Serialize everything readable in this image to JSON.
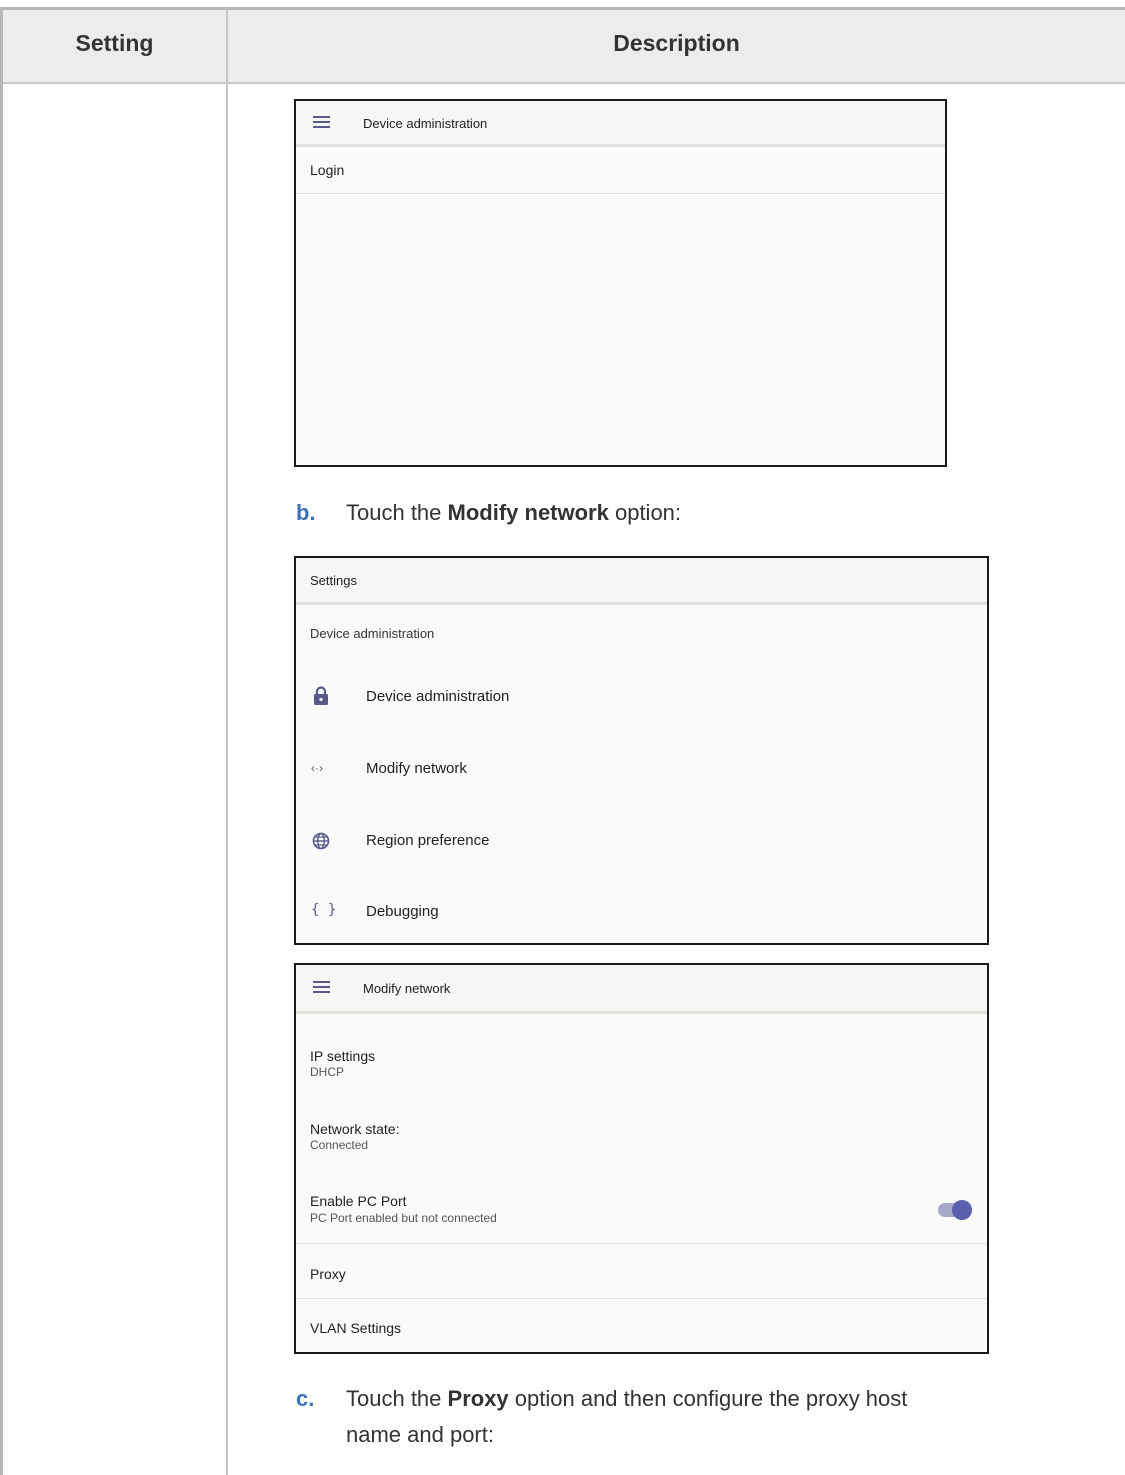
{
  "table": {
    "header_setting": "Setting",
    "header_description": "Description"
  },
  "shot1": {
    "title": "Device administration",
    "row_login": "Login"
  },
  "step_b": {
    "letter": "b.",
    "before": "Touch the ",
    "bold": "Modify network",
    "after": " option:"
  },
  "shot2": {
    "title": "Settings",
    "section": "Device administration",
    "items": [
      {
        "icon": "lock-icon",
        "label": "Device administration"
      },
      {
        "icon": "network-arrows-icon",
        "label": "Modify network"
      },
      {
        "icon": "globe-icon",
        "label": "Region preference"
      },
      {
        "icon": "braces-icon",
        "label": "Debugging"
      }
    ]
  },
  "shot3": {
    "title": "Modify network",
    "ip_label": "IP settings",
    "ip_value": "DHCP",
    "state_label": "Network state:",
    "state_value": "Connected",
    "pc_label": "Enable PC Port",
    "pc_value": "PC Port enabled but not connected",
    "proxy": "Proxy",
    "vlan": "VLAN Settings"
  },
  "step_c": {
    "letter": "c.",
    "before": "Touch the ",
    "bold": "Proxy",
    "after": " option and then configure the proxy host",
    "line2": "name and port:"
  },
  "colors": {
    "accent": "#3c73b6",
    "icon": "#595987",
    "toggle": "#5b5fae"
  }
}
